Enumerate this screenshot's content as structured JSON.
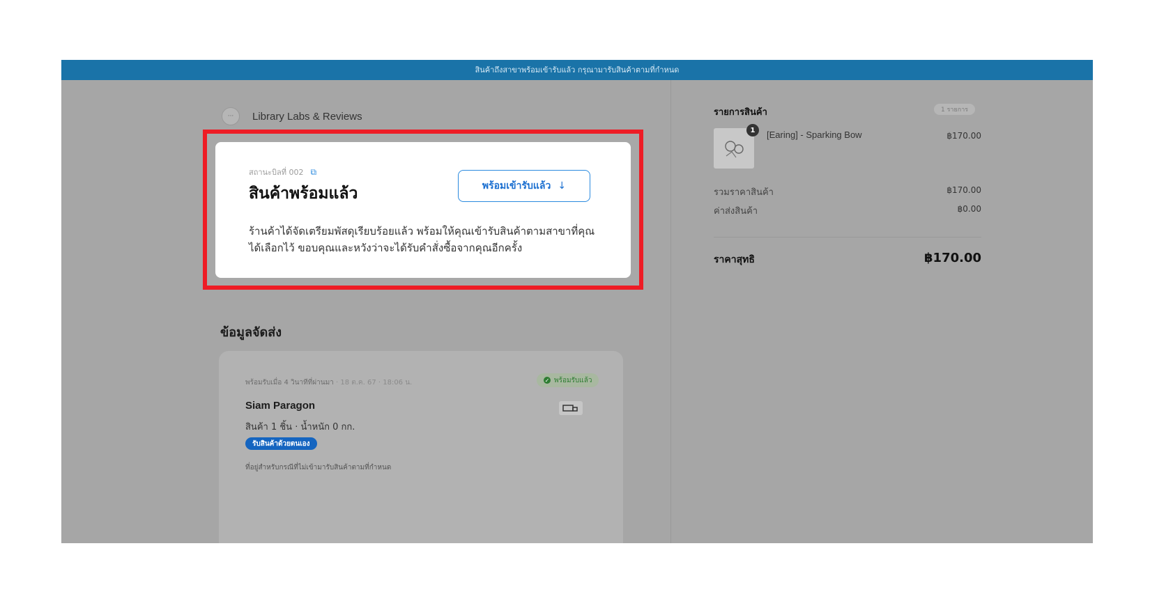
{
  "banner": {
    "text": "สินค้าถึงสาขาพร้อมเข้ารับแล้ว กรุณามารับสินค้าตามที่กำหนด"
  },
  "store": {
    "logo_text": "···",
    "name": "Library Labs & Reviews"
  },
  "status": {
    "bill_label": "สถานะบิลที่ 002",
    "title": "สินค้าพร้อมแล้ว",
    "button_label": "พร้อมเข้ารับแล้ว",
    "button_icon": "↓",
    "description": "ร้านค้าได้จัดเตรียมพัสดุเรียบร้อยแล้ว พร้อมให้คุณเข้ารับสินค้าตามสาขาที่คุณได้เลือกไว้ ขอบคุณและหวังว่าจะได้รับคำสั่งซื้อจากคุณอีกครั้ง"
  },
  "shipping": {
    "section_title": "ข้อมูลจัดส่ง",
    "ready_time": "พร้อมรับเมื่อ 4 วินาทีที่ผ่านมา",
    "date": "· 18 ต.ค. 67 · 18:06 น.",
    "badge": "พร้อมรับแล้ว",
    "branch": "Siam Paragon",
    "meta": "สินค้า 1 ชิ้น · น้ำหนัก 0 กก.",
    "pickup_label": "รับสินค้าด้วยตนเอง",
    "note": "ที่อยู่สำหรับกรณีที่ไม่เข้ามารับสินค้าตามที่กำหนด"
  },
  "summary": {
    "title": "รายการสินค้า",
    "count": "1 รายการ",
    "product": {
      "qty": "1",
      "name": "[Earing] - Sparking Bow",
      "price": "฿170.00"
    },
    "subtotal_label": "รวมราคาสินค้า",
    "subtotal": "฿170.00",
    "shipping_label": "ค่าส่งสินค้า",
    "shipping": "฿0.00",
    "total_label": "ราคาสุทธิ",
    "total": "฿170.00"
  },
  "colors": {
    "banner": "#1a73a8",
    "highlight": "#ee1c25",
    "accent": "#2a8adf",
    "success": "#2e7d32"
  }
}
